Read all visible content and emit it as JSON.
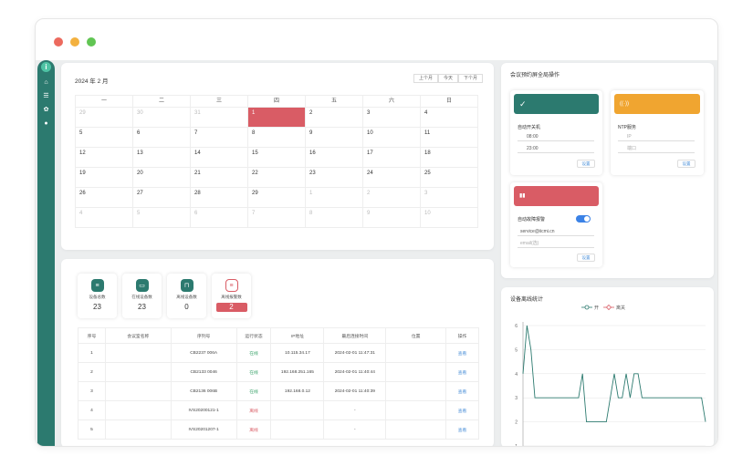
{
  "window": {
    "controls": [
      "close",
      "minimize",
      "maximize"
    ]
  },
  "sidebar": {
    "logo": "i",
    "items": [
      {
        "icon": "home-icon",
        "glyph": "⌂"
      },
      {
        "icon": "list-icon",
        "glyph": "☰"
      },
      {
        "icon": "gear-icon",
        "glyph": "✿"
      },
      {
        "icon": "user-icon",
        "glyph": "●"
      }
    ]
  },
  "calendar": {
    "title": "2024 年 2 月",
    "buttons": [
      "上个月",
      "今天",
      "下个月"
    ],
    "weekdays": [
      "一",
      "二",
      "三",
      "四",
      "五",
      "六",
      "日"
    ],
    "weeks": [
      [
        "29",
        "30",
        "31",
        "1",
        "2",
        "3",
        "4"
      ],
      [
        "5",
        "6",
        "7",
        "8",
        "9",
        "10",
        "11"
      ],
      [
        "12",
        "13",
        "14",
        "15",
        "16",
        "17",
        "18"
      ],
      [
        "19",
        "20",
        "21",
        "22",
        "23",
        "24",
        "25"
      ],
      [
        "26",
        "27",
        "28",
        "29",
        "1",
        "2",
        "3"
      ],
      [
        "4",
        "5",
        "6",
        "7",
        "8",
        "9",
        "10"
      ]
    ]
  },
  "stats": [
    {
      "label": "设备总数",
      "value": "23",
      "color": "#2c7a6f",
      "icon": "server-icon",
      "glyph": "≡"
    },
    {
      "label": "在线设备数",
      "value": "23",
      "color": "#2c7a6f",
      "icon": "monitor-icon",
      "glyph": "▭"
    },
    {
      "label": "离线设备数",
      "value": "0",
      "color": "#2c7a6f",
      "icon": "router-icon",
      "glyph": "⊓"
    },
    {
      "label": "离线报警数",
      "value": "2",
      "color": "#d95c65",
      "icon": "alarm-server-icon",
      "glyph": "≡"
    }
  ],
  "table": {
    "headers": [
      "序号",
      "会议室名称",
      "序列号",
      "运行状态",
      "IP地址",
      "最后连接时间",
      "位置",
      "操作"
    ],
    "rows": [
      [
        "1",
        "",
        "CB2237 006A",
        "在线",
        "10.115.34.17",
        "2024-02-01 11:47:31",
        "",
        "查看"
      ],
      [
        "2",
        "",
        "CB2133 0046",
        "在线",
        "192.168.251.165",
        "2024-02-01 11:40:44",
        "",
        "查看"
      ],
      [
        "3",
        "",
        "CB2136 006B",
        "在线",
        "192.168.0.12",
        "2024-02-01 11:40:39",
        "",
        "查看"
      ],
      [
        "4",
        "",
        "IVS20200121-1",
        "离线",
        "",
        "-",
        "",
        "查看"
      ],
      [
        "5",
        "",
        "IVS20201207-1",
        "离线",
        "",
        "-",
        "",
        "查看"
      ]
    ]
  },
  "global": {
    "title": "会议预约屏全局操作",
    "power": {
      "color": "#2c7a6f",
      "icon": "check-circle-icon",
      "glyph": "✓",
      "label": "自动开关机",
      "on_time": "08:00",
      "off_time": "23:00",
      "button": "设置"
    },
    "ntp": {
      "color": "#f0a530",
      "icon": "broadcast-icon",
      "glyph": "((·))",
      "label": "NTP服务",
      "ip_placeholder": "IP",
      "port_placeholder": "端口",
      "button": "设置"
    },
    "alarm": {
      "color": "#d95c65",
      "icon": "bar-chart-icon",
      "glyph": "▮▮",
      "label": "自动故障报警",
      "toggle": true,
      "email1": "service@iicmi.cn",
      "email2_placeholder": "email(选)",
      "button": "设置"
    }
  },
  "offline_chart": {
    "title": "设备离线统计"
  },
  "chart_data": {
    "type": "line",
    "title": "",
    "series": [
      {
        "name": "开",
        "color": "#2c7a6f",
        "values": [
          4,
          6,
          5,
          3,
          3,
          3,
          3,
          3,
          3,
          3,
          3,
          3,
          3,
          3,
          3,
          4,
          2,
          2,
          2,
          2,
          2,
          2,
          3,
          4,
          3,
          3,
          4,
          3,
          4,
          4,
          3,
          3,
          3,
          3,
          3,
          3,
          3,
          3,
          3,
          3,
          3,
          3,
          3,
          3,
          3,
          3,
          2
        ]
      },
      {
        "name": "离关",
        "color": "#d95c65",
        "values": []
      }
    ],
    "ylim": [
      1,
      6
    ],
    "yticks": [
      "6",
      "5",
      "4",
      "3",
      "2",
      "1"
    ]
  }
}
